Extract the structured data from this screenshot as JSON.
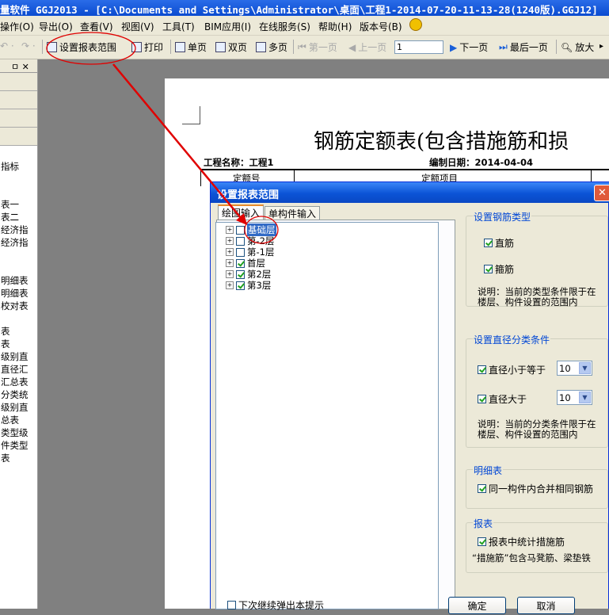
{
  "window": {
    "title": "量软件 GGJ2013 - [C:\\Documents and Settings\\Administrator\\桌面\\工程1-2014-07-20-11-13-28(1240版).GGJ12]"
  },
  "menu": [
    "操作(O)",
    "导出(O)",
    "查看(V)",
    "视图(V)",
    "工具(T)",
    "BIM应用(I)",
    "在线服务(S)",
    "帮助(H)",
    "版本号(B)"
  ],
  "toolbar": {
    "undo": "↶ ·",
    "redo": "↷ ·",
    "set_range": "设置报表范围",
    "print": "打印",
    "single": "单页",
    "double": "双页",
    "multi": "多页",
    "first": "第一页",
    "prev": "上一页",
    "page_value": "1",
    "next": "下一页",
    "last": "最后一页",
    "zoom": "放大"
  },
  "left_panel": {
    "header": "ㅁ ✕",
    "items": [
      "指标",
      "表一",
      "表二",
      "经济指",
      "经济指",
      "明细表",
      "明细表",
      "校对表",
      "表",
      "表",
      "级别直",
      "直径汇",
      "汇总表",
      "分类统",
      "级别直",
      "总表",
      "类型级",
      "件类型",
      "表"
    ]
  },
  "report": {
    "title": "钢筋定额表(包含措施筋和损",
    "project_label": "工程名称：工程1",
    "date_label": "编制日期：2014-04-04",
    "col1": "定额号",
    "col2": "定额项目"
  },
  "dialog": {
    "title": "设置报表范围",
    "close": "✕",
    "tabs": [
      "绘图输入",
      "单构件输入"
    ],
    "tree": [
      {
        "label": "基础层",
        "checked": false,
        "selected": true
      },
      {
        "label": "第-2层",
        "checked": false
      },
      {
        "label": "第-1层",
        "checked": false
      },
      {
        "label": "首层",
        "checked": true
      },
      {
        "label": "第2层",
        "checked": true
      },
      {
        "label": "第3层",
        "checked": true
      }
    ],
    "rebar_type": {
      "title": "设置钢筋类型",
      "straight": "直筋",
      "stirrup": "箍筋",
      "note": "说明：当前的类型条件限于在楼层、构件设置的范围内"
    },
    "diameter": {
      "title": "设置直径分类条件",
      "less_label": "直径小于等于",
      "less_value": "10",
      "greater_label": "直径大于",
      "greater_value": "10",
      "note": "说明：当前的分类条件限于在楼层、构件设置的范围内"
    },
    "detail": {
      "title": "明细表",
      "merge": "同一构件内合并相同钢筋"
    },
    "report_group": {
      "title": "报表",
      "measures": "报表中统计措施筋",
      "note": "“措施筋”包含马凳筋、梁垫铁"
    },
    "no_show_again": "下次继续弹出本提示",
    "ok": "确定",
    "cancel": "取消"
  },
  "colors": {
    "title_blue": "#0a4bd0",
    "annotation_red": "#e00000",
    "group_title": "#0046d5"
  }
}
